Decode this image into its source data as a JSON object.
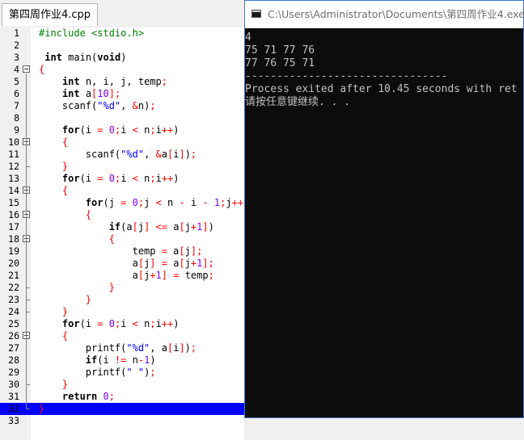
{
  "editor": {
    "tab_label": "第四周作业4.cpp",
    "lines": [
      {
        "n": "1",
        "html": "<span class=\"pp\">#include &lt;stdio.h&gt;</span>"
      },
      {
        "n": "2",
        "html": ""
      },
      {
        "n": "3",
        "html": " <span class=\"kw\">int</span> main(<span class=\"kw\">void</span>)"
      },
      {
        "n": "4",
        "html": "<span class=\"sym\">{</span>"
      },
      {
        "n": "5",
        "html": "    <span class=\"kw\">int</span> n, i, j, temp<span class=\"sym\">;</span>"
      },
      {
        "n": "6",
        "html": "    <span class=\"kw\">int</span> a<span class=\"sym\">[</span><span class=\"num\">10</span><span class=\"sym\">];</span>"
      },
      {
        "n": "7",
        "html": "    scanf(<span class=\"str\">\"%d\"</span>, <span class=\"sym\">&amp;</span>n)<span class=\"sym\">;</span>"
      },
      {
        "n": "8",
        "html": ""
      },
      {
        "n": "9",
        "html": "    <span class=\"kw\">for</span>(i <span class=\"sym\">=</span> <span class=\"num\">0</span><span class=\"sym\">;</span>i <span class=\"sym\">&lt;</span> n<span class=\"sym\">;</span>i<span class=\"sym\">++</span>)"
      },
      {
        "n": "10",
        "html": "    <span class=\"sym\">{</span>"
      },
      {
        "n": "11",
        "html": "        scanf(<span class=\"str\">\"%d\"</span>, <span class=\"sym\">&amp;</span>a<span class=\"sym\">[</span>i<span class=\"sym\">]</span>)<span class=\"sym\">;</span>"
      },
      {
        "n": "12",
        "html": "    <span class=\"sym\">}</span>"
      },
      {
        "n": "13",
        "html": "    <span class=\"kw\">for</span>(i <span class=\"sym\">=</span> <span class=\"num\">0</span><span class=\"sym\">;</span>i <span class=\"sym\">&lt;</span> n<span class=\"sym\">;</span>i<span class=\"sym\">++</span>)"
      },
      {
        "n": "14",
        "html": "    <span class=\"sym\">{</span>"
      },
      {
        "n": "15",
        "html": "        <span class=\"kw\">for</span>(j <span class=\"sym\">=</span> <span class=\"num\">0</span><span class=\"sym\">;</span>j <span class=\"sym\">&lt;</span> n <span class=\"sym\">-</span> i <span class=\"sym\">-</span> <span class=\"num\">1</span><span class=\"sym\">;</span>j<span class=\"sym\">++</span>)"
      },
      {
        "n": "16",
        "html": "        <span class=\"sym\">{</span>"
      },
      {
        "n": "17",
        "html": "            <span class=\"kw\">if</span>(a<span class=\"sym\">[</span>j<span class=\"sym\">]</span> <span class=\"sym\">&lt;=</span> a<span class=\"sym\">[</span>j<span class=\"sym\">+</span><span class=\"num\">1</span><span class=\"sym\">]</span>)"
      },
      {
        "n": "18",
        "html": "            <span class=\"sym\">{</span>"
      },
      {
        "n": "19",
        "html": "                temp <span class=\"sym\">=</span> a<span class=\"sym\">[</span>j<span class=\"sym\">];</span>"
      },
      {
        "n": "20",
        "html": "                a<span class=\"sym\">[</span>j<span class=\"sym\">]</span> <span class=\"sym\">=</span> a<span class=\"sym\">[</span>j<span class=\"sym\">+</span><span class=\"num\">1</span><span class=\"sym\">];</span>"
      },
      {
        "n": "21",
        "html": "                a<span class=\"sym\">[</span>j<span class=\"sym\">+</span><span class=\"num\">1</span><span class=\"sym\">]</span> <span class=\"sym\">=</span> temp<span class=\"sym\">;</span>"
      },
      {
        "n": "22",
        "html": "            <span class=\"sym\">}</span>"
      },
      {
        "n": "23",
        "html": "        <span class=\"sym\">}</span>"
      },
      {
        "n": "24",
        "html": "    <span class=\"sym\">}</span>"
      },
      {
        "n": "25",
        "html": "    <span class=\"kw\">for</span>(i <span class=\"sym\">=</span> <span class=\"num\">0</span><span class=\"sym\">;</span>i <span class=\"sym\">&lt;</span> n<span class=\"sym\">;</span>i<span class=\"sym\">++</span>)"
      },
      {
        "n": "26",
        "html": "    <span class=\"sym\">{</span>"
      },
      {
        "n": "27",
        "html": "        printf(<span class=\"str\">\"%d\"</span>, a<span class=\"sym\">[</span>i<span class=\"sym\">]</span>)<span class=\"sym\">;</span>"
      },
      {
        "n": "28",
        "html": "        <span class=\"kw\">if</span>(i <span class=\"sym\">!=</span> n<span class=\"sym\">-</span><span class=\"num\">1</span>)"
      },
      {
        "n": "29",
        "html": "        printf(<span class=\"str\">\" \"</span>)<span class=\"sym\">;</span>"
      },
      {
        "n": "30",
        "html": "    <span class=\"sym\">}</span>"
      },
      {
        "n": "31",
        "html": "    <span class=\"kw\">return</span> <span class=\"num\">0</span><span class=\"sym\">;</span>"
      },
      {
        "n": "32",
        "html": "<span class=\"sym\">}</span>"
      },
      {
        "n": "33",
        "html": ""
      }
    ],
    "fold_markers": [
      "4",
      "10",
      "14",
      "16",
      "18",
      "26"
    ]
  },
  "console": {
    "title": "C:\\Users\\Administrator\\Documents\\第四周作业4.exe",
    "output_lines": [
      "4",
      "75 71 77 76",
      "77 76 75 71",
      "--------------------------------",
      "Process exited after 10.45 seconds with ret",
      "请按任意键继续. . ."
    ]
  },
  "colors": {
    "keyword": "#000000",
    "preprocessor": "#008000",
    "number": "#8000ff",
    "string": "#0000ff",
    "symbol": "#ff0000",
    "current_line": "#0000ff",
    "console_bg": "#0c0c0c",
    "console_text": "#c0c0c0"
  }
}
